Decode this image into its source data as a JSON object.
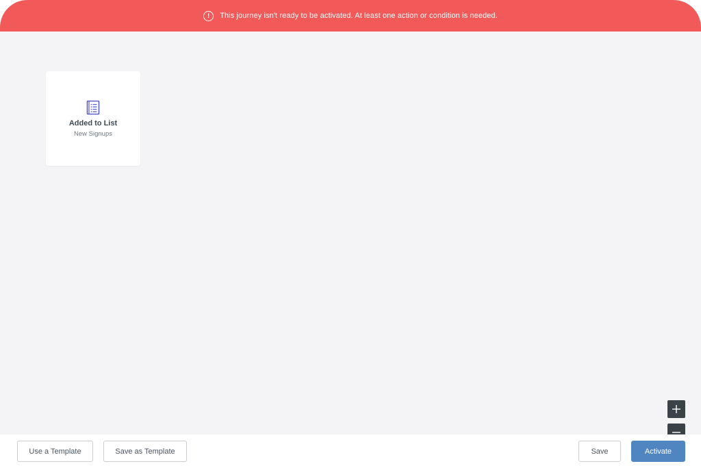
{
  "banner": {
    "message": "This journey isn't ready to be activated. At least one action or condition is needed.",
    "icon": "alert-circle-icon",
    "icon_glyph": "!",
    "color": "#f25a5a"
  },
  "canvas": {
    "node": {
      "icon": "list-icon",
      "title": "Added to List",
      "subtitle": "New Signups",
      "icon_color": "#5b5fc7"
    },
    "zoom": {
      "in_icon": "plus-icon",
      "out_icon": "minus-icon"
    }
  },
  "footer": {
    "use_template_label": "Use a Template",
    "save_as_template_label": "Save as Template",
    "save_label": "Save",
    "activate_label": "Activate",
    "accent_color": "#4f86c1"
  }
}
